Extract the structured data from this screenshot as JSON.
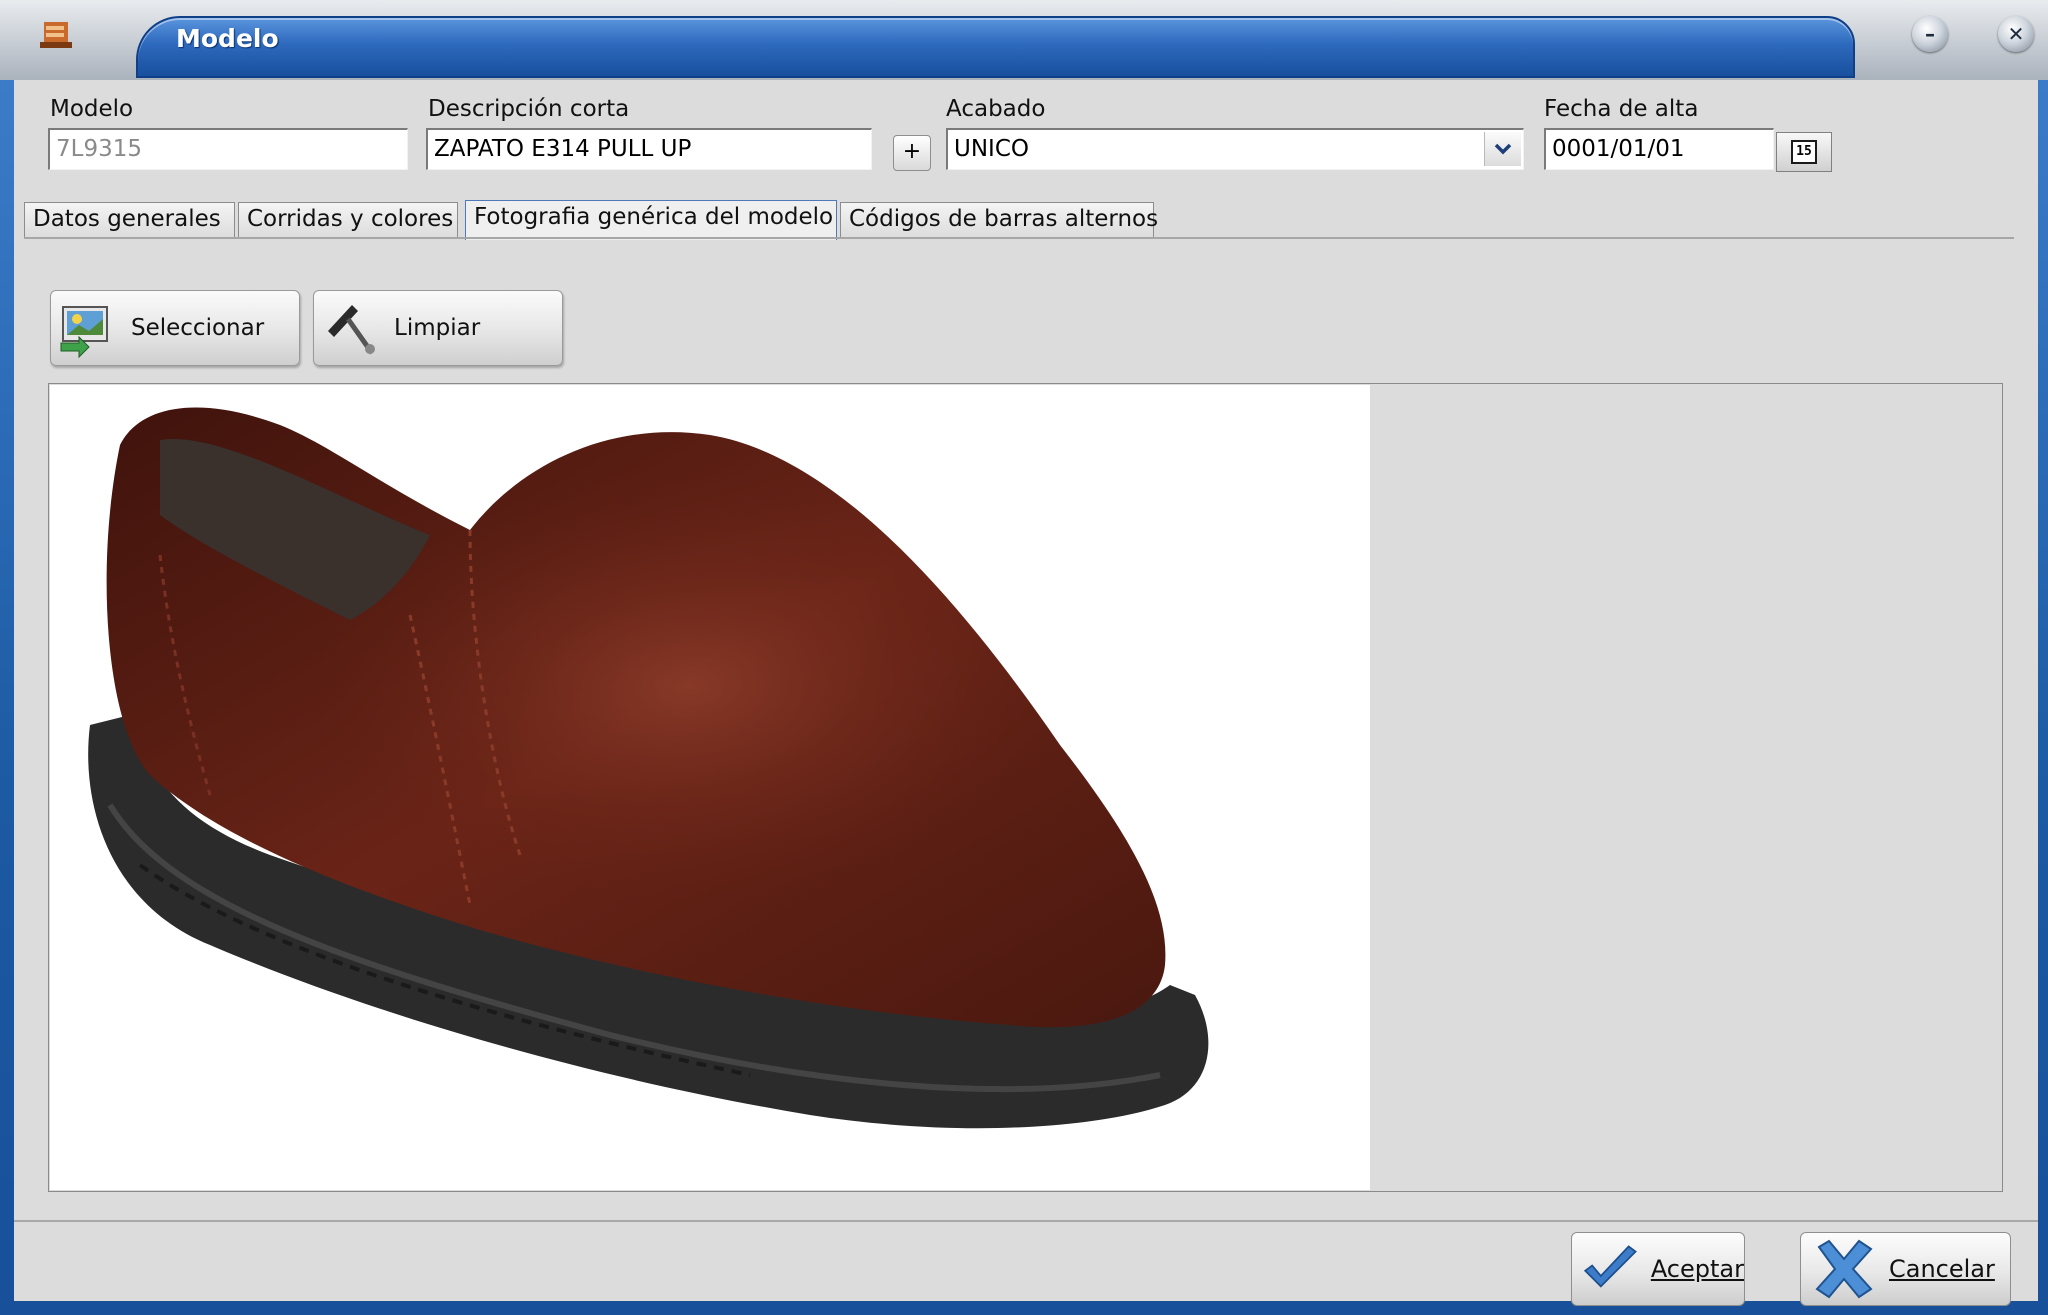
{
  "window": {
    "title": "Modelo",
    "buttons": [
      "minimize-icon",
      "close-icon"
    ]
  },
  "form": {
    "modelo": {
      "label": "Modelo",
      "value": "7L9315"
    },
    "descripcion": {
      "label": "Descripción corta",
      "value": "ZAPATO E314 PULL UP"
    },
    "acabado": {
      "label": "Acabado",
      "add_label": "+",
      "value": "UNICO"
    },
    "fecha": {
      "label": "Fecha de alta",
      "value": "0001/01/01",
      "calendar_label": "15"
    }
  },
  "tabs": [
    {
      "label": "Datos generales"
    },
    {
      "label": "Corridas y colores"
    },
    {
      "label": "Fotografia genérica del modelo",
      "active": true
    },
    {
      "label": "Códigos de barras alternos"
    }
  ],
  "toolbar": {
    "select_label": "Seleccionar",
    "clear_label": "Limpiar"
  },
  "dialog": {
    "ok_label": "Aceptar",
    "cancel_label": "Cancelar"
  },
  "colors": {
    "title_blue": "#2d69bd",
    "frame_blue": "#1c5aa3",
    "panel": "#dcdcdc",
    "shoe": "#6b2216"
  }
}
